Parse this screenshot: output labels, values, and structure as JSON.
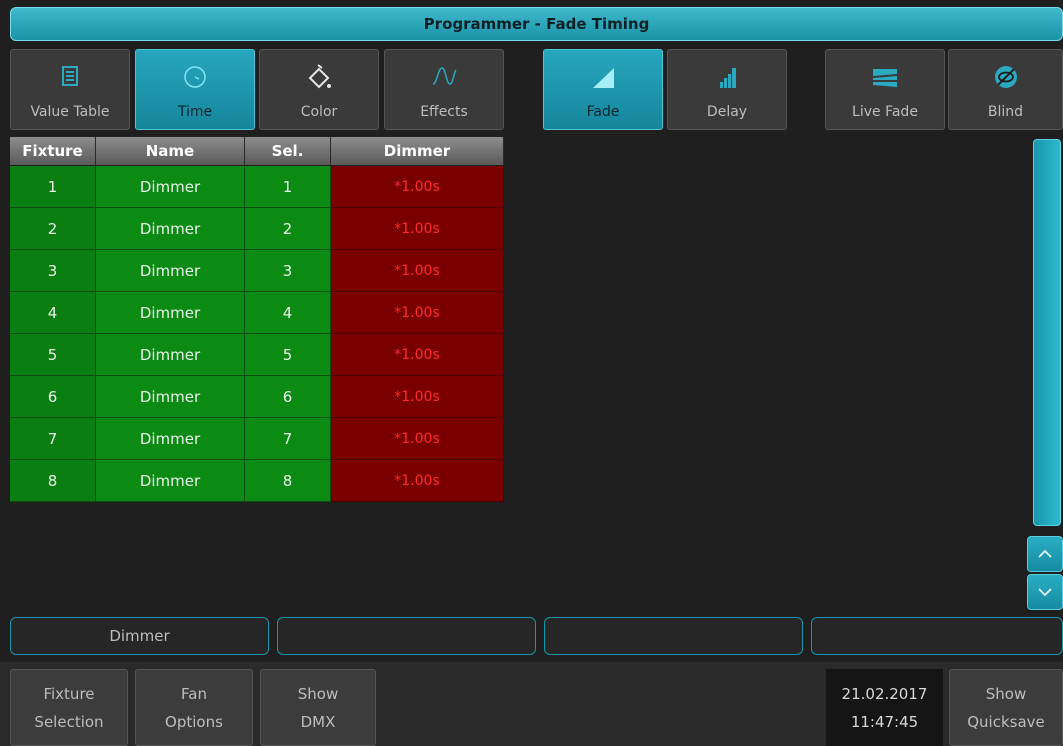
{
  "title": "Programmer - Fade Timing",
  "toolbar": {
    "value_table": "Value Table",
    "time": "Time",
    "color": "Color",
    "effects": "Effects",
    "fade": "Fade",
    "delay": "Delay",
    "live_fade": "Live Fade",
    "blind": "Blind"
  },
  "icons": {
    "value_table": "table-icon",
    "time": "clock-icon",
    "color": "paint-bucket-icon",
    "effects": "wave-icon",
    "fade": "fade-ramp-icon",
    "delay": "delay-bars-icon",
    "live_fade": "live-fade-icon",
    "blind": "blind-icon"
  },
  "colors": {
    "accent": "#1fa0b6",
    "selected_green": "#0b8a14",
    "value_red_bg": "#7a0000",
    "value_red_text": "#ff2a2a"
  },
  "table": {
    "headers": [
      "Fixture",
      "Name",
      "Sel.",
      "Dimmer"
    ],
    "rows": [
      {
        "fixture": "1",
        "name": "Dimmer",
        "sel": "1",
        "dimmer": "*1.00s"
      },
      {
        "fixture": "2",
        "name": "Dimmer",
        "sel": "2",
        "dimmer": "*1.00s"
      },
      {
        "fixture": "3",
        "name": "Dimmer",
        "sel": "3",
        "dimmer": "*1.00s"
      },
      {
        "fixture": "4",
        "name": "Dimmer",
        "sel": "4",
        "dimmer": "*1.00s"
      },
      {
        "fixture": "5",
        "name": "Dimmer",
        "sel": "5",
        "dimmer": "*1.00s"
      },
      {
        "fixture": "6",
        "name": "Dimmer",
        "sel": "6",
        "dimmer": "*1.00s"
      },
      {
        "fixture": "7",
        "name": "Dimmer",
        "sel": "7",
        "dimmer": "*1.00s"
      },
      {
        "fixture": "8",
        "name": "Dimmer",
        "sel": "8",
        "dimmer": "*1.00s"
      }
    ]
  },
  "info_boxes": [
    "Dimmer",
    "",
    "",
    ""
  ],
  "bottom": {
    "fixture_selection": [
      "Fixture",
      "Selection"
    ],
    "fan_options": [
      "Fan",
      "Options"
    ],
    "show_dmx": [
      "Show",
      "DMX"
    ],
    "show_quicksave": [
      "Show",
      "Quicksave"
    ],
    "date": "21.02.2017",
    "time": "11:47:45"
  }
}
